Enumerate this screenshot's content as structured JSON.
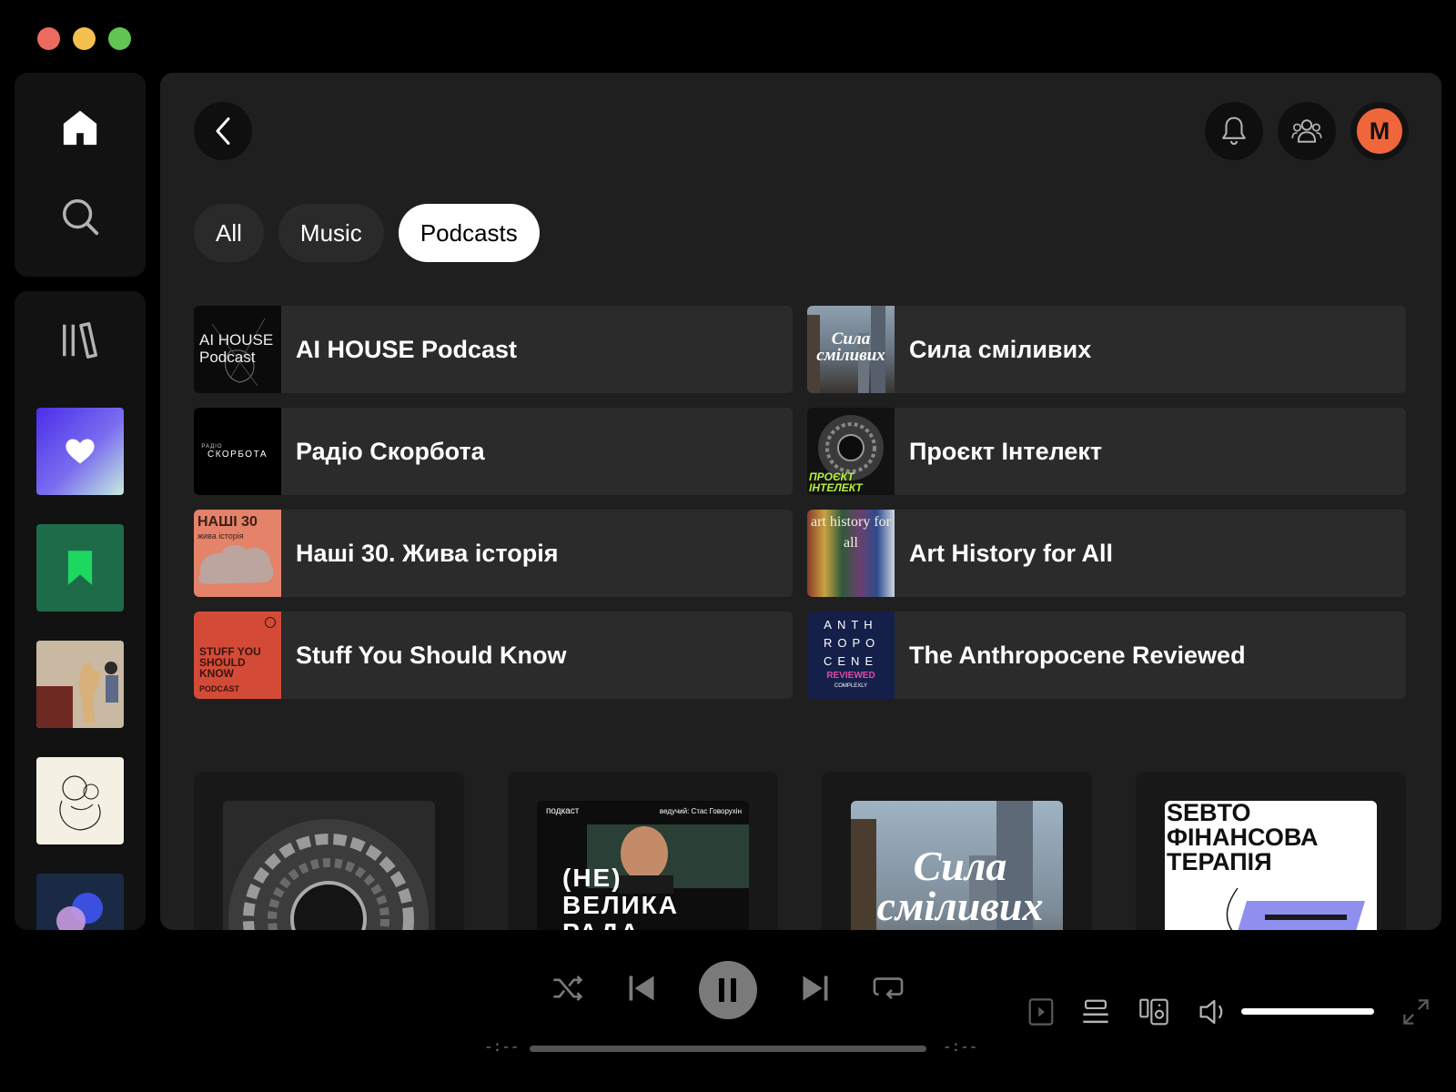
{
  "chips": {
    "all": "All",
    "music": "Music",
    "podcasts": "Podcasts"
  },
  "profile": {
    "initial": "M"
  },
  "shortcuts": [
    {
      "title": "AI HOUSE Podcast",
      "cover_text": "AI HOUSE Podcast"
    },
    {
      "title": "Сила сміливих",
      "cover_text": "Сила сміливих"
    },
    {
      "title": "Радіо Скорбота",
      "cover_text": "СКОРБОТА"
    },
    {
      "title": "Проєкт Інтелект",
      "cover_text": "ПРОЄКТ ІНТЕЛЕКТ"
    },
    {
      "title": "Наші 30. Жива історія",
      "cover_text": "НАШІ 30"
    },
    {
      "title": "Art History for All",
      "cover_text": "art history for all"
    },
    {
      "title": "Stuff You Should Know",
      "cover_text": "STUFF YOU SHOULD KNOW"
    },
    {
      "title": "The Anthropocene Reviewed",
      "cover_text": "ANTH ROPO CENE"
    }
  ],
  "shortcut_covers": {
    "skorbota_small": "РАДІО",
    "nashi_sub": "жива історія",
    "sysk_podcast": "PODCAST",
    "anthro_reviewed": "REVIEWED",
    "anthro_brand": "COMPLEXLY"
  },
  "cards": [
    {
      "cover_text": ""
    },
    {
      "cover_top_left": "подкаст",
      "cover_top_right": "ведучий: Стас Говорухін",
      "cover_text": "(НЕ) ВЕЛИКА РАДА"
    },
    {
      "cover_text": "Сила сміливих"
    },
    {
      "cover_text": "SEBTO ФІНАНСОВА ТЕРАПІЯ"
    }
  ],
  "player": {
    "elapsed": "-:--",
    "remaining": "-:--",
    "progress": 0,
    "volume": 1.0
  },
  "colors": {
    "accent_avatar": "#f0663b",
    "liked_gradient_start": "#4b2ee8",
    "saved_episodes": "#1e6b4a",
    "chip_active": "#ffffff",
    "chip_inactive": "#2a2a2a"
  }
}
